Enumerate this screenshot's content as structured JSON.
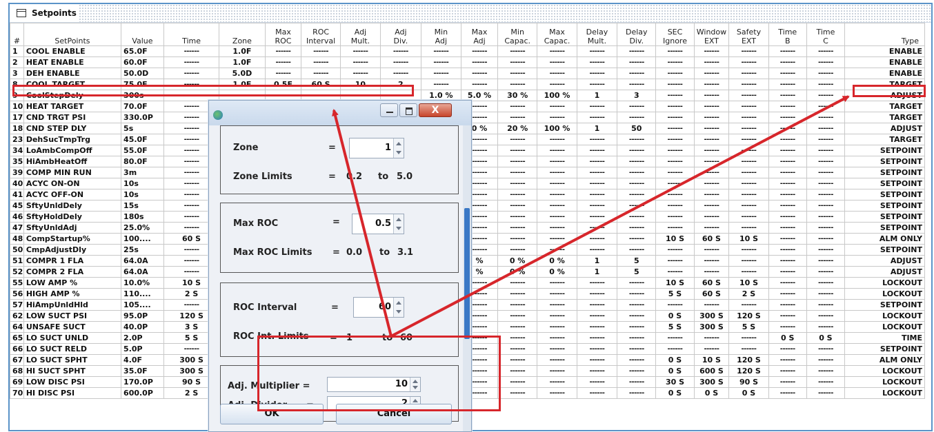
{
  "window": {
    "title": "Setpoints"
  },
  "table": {
    "headers": [
      [
        "",
        "#"
      ],
      [
        "",
        "SetPoints"
      ],
      [
        "",
        "Value"
      ],
      [
        "",
        "Time"
      ],
      [
        "",
        "Zone"
      ],
      [
        "Max",
        "ROC"
      ],
      [
        "ROC",
        "Interval"
      ],
      [
        "Adj",
        "Mult."
      ],
      [
        "Adj",
        "Div."
      ],
      [
        "Min",
        "Adj"
      ],
      [
        "Max",
        "Adj"
      ],
      [
        "Min",
        "Capac."
      ],
      [
        "Max",
        "Capac."
      ],
      [
        "Delay",
        "Mult."
      ],
      [
        "Delay",
        "Div."
      ],
      [
        "SEC",
        "Ignore"
      ],
      [
        "Window",
        "EXT"
      ],
      [
        "Safety",
        "EXT"
      ],
      [
        "Time",
        "B"
      ],
      [
        "Time",
        "C"
      ],
      [
        "",
        "Type"
      ]
    ],
    "rows": [
      [
        "1",
        "COOL ENABLE",
        "65.0F",
        "------",
        "1.0F",
        "------",
        "------",
        "------",
        "------",
        "------",
        "------",
        "------",
        "------",
        "------",
        "------",
        "------",
        "------",
        "------",
        "------",
        "------",
        "ENABLE"
      ],
      [
        "2",
        "HEAT ENABLE",
        "60.0F",
        "------",
        "1.0F",
        "------",
        "------",
        "------",
        "------",
        "------",
        "------",
        "------",
        "------",
        "------",
        "------",
        "------",
        "------",
        "------",
        "------",
        "------",
        "ENABLE"
      ],
      [
        "3",
        "DEH ENABLE",
        "50.0D",
        "------",
        "5.0D",
        "------",
        "------",
        "------",
        "------",
        "------",
        "------",
        "------",
        "------",
        "------",
        "------",
        "------",
        "------",
        "------",
        "------",
        "------",
        "ENABLE"
      ],
      [
        "8",
        "COOL TARGET",
        "75.0F",
        "------",
        "1.0F",
        "0.5F",
        "60 S",
        "10",
        "2",
        "------",
        "------",
        "------",
        "------",
        "------",
        "------",
        "------",
        "------",
        "------",
        "------",
        "------",
        "TARGET"
      ],
      [
        "9",
        "CoolStepDely",
        "300s",
        "------",
        "",
        "",
        "",
        "",
        "",
        "1.0 %",
        "5.0 %",
        "30 %",
        "100 %",
        "1",
        "3",
        "------",
        "------",
        "------",
        "------",
        "------",
        "ADJUST"
      ],
      [
        "10",
        "HEAT TARGET",
        "70.0F",
        "------",
        "",
        "",
        "",
        "",
        "",
        "",
        "------",
        "------",
        "------",
        "------",
        "------",
        "------",
        "------",
        "------",
        "------",
        "------",
        "TARGET"
      ],
      [
        "17",
        "CND TRGT PSI",
        "330.0P",
        "------",
        "",
        "",
        "",
        "",
        "",
        "",
        "------",
        "------",
        "------",
        "------",
        "------",
        "------",
        "------",
        "------",
        "------",
        "------",
        "TARGET"
      ],
      [
        "18",
        "CND STEP DLY",
        "5s",
        "------",
        "",
        "",
        "",
        "",
        "",
        "",
        "0 %",
        "20 %",
        "100 %",
        "1",
        "50",
        "------",
        "------",
        "------",
        "------",
        "------",
        "ADJUST"
      ],
      [
        "23",
        "DehSucTmpTrg",
        "45.0F",
        "------",
        "",
        "",
        "",
        "",
        "",
        "",
        "------",
        "------",
        "------",
        "------",
        "------",
        "------",
        "------",
        "------",
        "------",
        "------",
        "TARGET"
      ],
      [
        "34",
        "LoAmbCompOff",
        "55.0F",
        "------",
        "",
        "",
        "",
        "",
        "",
        "",
        "------",
        "------",
        "------",
        "------",
        "------",
        "------",
        "------",
        "------",
        "------",
        "------",
        "SETPOINT"
      ],
      [
        "35",
        "HiAmbHeatOff",
        "80.0F",
        "------",
        "",
        "",
        "",
        "",
        "",
        "",
        "------",
        "------",
        "------",
        "------",
        "------",
        "------",
        "------",
        "------",
        "------",
        "------",
        "SETPOINT"
      ],
      [
        "39",
        "COMP MIN RUN",
        "3m",
        "------",
        "",
        "",
        "",
        "",
        "",
        "",
        "------",
        "------",
        "------",
        "------",
        "------",
        "------",
        "------",
        "------",
        "------",
        "------",
        "SETPOINT"
      ],
      [
        "40",
        "ACYC ON-ON",
        "10s",
        "------",
        "",
        "",
        "",
        "",
        "",
        "",
        "------",
        "------",
        "------",
        "------",
        "------",
        "------",
        "------",
        "------",
        "------",
        "------",
        "SETPOINT"
      ],
      [
        "41",
        "ACYC OFF-ON",
        "10s",
        "------",
        "",
        "",
        "",
        "",
        "",
        "",
        "------",
        "------",
        "------",
        "------",
        "------",
        "------",
        "------",
        "------",
        "------",
        "------",
        "SETPOINT"
      ],
      [
        "45",
        "SftyUnldDely",
        "15s",
        "------",
        "",
        "",
        "",
        "",
        "",
        "",
        "------",
        "------",
        "------",
        "------",
        "------",
        "------",
        "------",
        "------",
        "------",
        "------",
        "SETPOINT"
      ],
      [
        "46",
        "SftyHoldDely",
        "180s",
        "------",
        "",
        "",
        "",
        "",
        "",
        "",
        "------",
        "------",
        "------",
        "------",
        "------",
        "------",
        "------",
        "------",
        "------",
        "------",
        "SETPOINT"
      ],
      [
        "47",
        "SftyUnldAdj",
        "25.0%",
        "------",
        "",
        "",
        "",
        "",
        "",
        "",
        "------",
        "------",
        "------",
        "------",
        "------",
        "------",
        "------",
        "------",
        "------",
        "------",
        "SETPOINT"
      ],
      [
        "48",
        "CompStartup%",
        "100....",
        "60 S",
        "",
        "",
        "",
        "",
        "",
        "",
        "------",
        "------",
        "------",
        "------",
        "------",
        "10 S",
        "60 S",
        "10 S",
        "------",
        "------",
        "ALM ONLY"
      ],
      [
        "50",
        "CmpAdjustDly",
        "25s",
        "------",
        "",
        "",
        "",
        "",
        "",
        "",
        "------",
        "------",
        "------",
        "------",
        "------",
        "------",
        "------",
        "------",
        "------",
        "------",
        "SETPOINT"
      ],
      [
        "51",
        "COMPR 1 FLA",
        "64.0A",
        "------",
        "",
        "",
        "",
        "",
        "",
        "",
        "%",
        "0 %",
        "0 %",
        "1",
        "5",
        "------",
        "------",
        "------",
        "------",
        "------",
        "ADJUST"
      ],
      [
        "52",
        "COMPR 2 FLA",
        "64.0A",
        "------",
        "",
        "",
        "",
        "",
        "",
        "",
        "%",
        "0 %",
        "0 %",
        "1",
        "5",
        "------",
        "------",
        "------",
        "------",
        "------",
        "ADJUST"
      ],
      [
        "55",
        "LOW AMP %",
        "10.0%",
        "10 S",
        "",
        "",
        "",
        "",
        "",
        "",
        "------",
        "------",
        "------",
        "------",
        "------",
        "10 S",
        "60 S",
        "10 S",
        "------",
        "------",
        "LOCKOUT"
      ],
      [
        "56",
        "HIGH AMP %",
        "110....",
        "2 S",
        "",
        "",
        "",
        "",
        "",
        "",
        "------",
        "------",
        "------",
        "------",
        "------",
        "5 S",
        "60 S",
        "2 S",
        "------",
        "------",
        "LOCKOUT"
      ],
      [
        "57",
        "HiAmpUnldHld",
        "105....",
        "------",
        "",
        "",
        "",
        "",
        "",
        "",
        "------",
        "------",
        "------",
        "------",
        "------",
        "------",
        "------",
        "------",
        "------",
        "------",
        "SETPOINT"
      ],
      [
        "62",
        "LOW SUCT PSI",
        "95.0P",
        "120 S",
        "",
        "",
        "",
        "",
        "",
        "",
        "------",
        "------",
        "------",
        "------",
        "------",
        "0 S",
        "300 S",
        "120 S",
        "------",
        "------",
        "LOCKOUT"
      ],
      [
        "64",
        "UNSAFE SUCT",
        "40.0P",
        "3 S",
        "",
        "",
        "",
        "",
        "",
        "",
        "------",
        "------",
        "------",
        "------",
        "------",
        "5 S",
        "300 S",
        "5 S",
        "------",
        "------",
        "LOCKOUT"
      ],
      [
        "65",
        "LO SUCT UNLD",
        "2.0P",
        "5 S",
        "",
        "",
        "",
        "",
        "",
        "",
        "------",
        "------",
        "------",
        "------",
        "------",
        "------",
        "------",
        "------",
        "0 S",
        "0 S",
        "TIME"
      ],
      [
        "66",
        "LO SUCT RELD",
        "5.0P",
        "------",
        "",
        "",
        "",
        "",
        "",
        "",
        "------",
        "------",
        "------",
        "------",
        "------",
        "------",
        "------",
        "------",
        "------",
        "------",
        "SETPOINT"
      ],
      [
        "67",
        "LO SUCT SPHT",
        "4.0F",
        "300 S",
        "",
        "",
        "",
        "",
        "",
        "",
        "------",
        "------",
        "------",
        "------",
        "------",
        "0 S",
        "10 S",
        "120 S",
        "------",
        "------",
        "ALM ONLY"
      ],
      [
        "68",
        "HI SUCT SPHT",
        "35.0F",
        "300 S",
        "",
        "",
        "",
        "",
        "",
        "",
        "------",
        "------",
        "------",
        "------",
        "------",
        "0 S",
        "600 S",
        "120 S",
        "------",
        "------",
        "LOCKOUT"
      ],
      [
        "69",
        "LOW DISC PSI",
        "170.0P",
        "90 S",
        "",
        "",
        "",
        "",
        "",
        "",
        "------",
        "------",
        "------",
        "------",
        "------",
        "30 S",
        "300 S",
        "90 S",
        "------",
        "------",
        "LOCKOUT"
      ],
      [
        "70",
        "HI DISC PSI",
        "600.0P",
        "2 S",
        "",
        "",
        "",
        "",
        "",
        "",
        "------",
        "------",
        "------",
        "------",
        "------",
        "0 S",
        "0 S",
        "0 S",
        "------",
        "------",
        "LOCKOUT"
      ]
    ]
  },
  "dialog": {
    "close_glyph": "X",
    "zone": {
      "label": "Zone",
      "eq": "=",
      "value": "1",
      "limits_label": "Zone Limits",
      "limits_eq": "=",
      "min": "0.2",
      "to": "to",
      "max": "5.0"
    },
    "max_roc": {
      "label": "Max ROC",
      "eq": "=",
      "value": "0.5",
      "limits_label": "Max ROC Limits",
      "limits_eq": "=",
      "min": "0.0",
      "to": "to",
      "max": "3.1"
    },
    "roc_interval": {
      "label": "ROC Interval",
      "eq": "=",
      "value": "60",
      "limits_label": "ROC Int. Limits",
      "limits_eq": "=",
      "min": "1",
      "to": "to",
      "max": "60"
    },
    "adj": {
      "mult_label": "Adj. Multiplier =",
      "mult_value": "10",
      "div_label": "Adj. Divider",
      "div_eq": "=",
      "div_value": "2"
    },
    "ok_label": "OK",
    "cancel_label": "Cancel"
  },
  "annotations": {
    "color": "#d7262b"
  }
}
